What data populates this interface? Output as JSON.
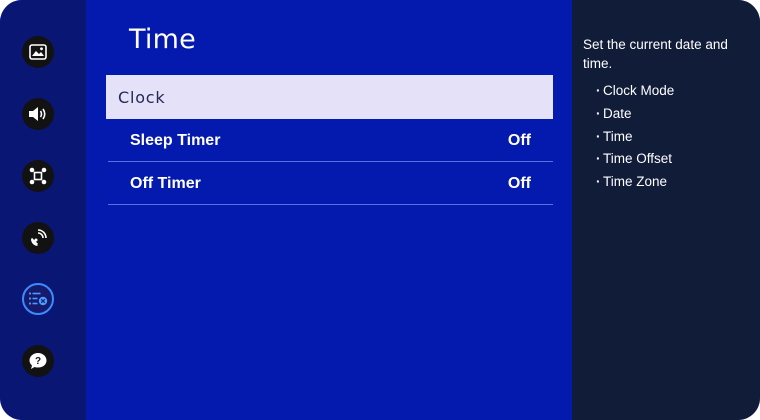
{
  "sidebar": {
    "items": [
      {
        "icon": "picture-icon",
        "active": false
      },
      {
        "icon": "sound-icon",
        "active": false
      },
      {
        "icon": "connection-icon",
        "active": false
      },
      {
        "icon": "broadcasting-icon",
        "active": false
      },
      {
        "icon": "general-settings-icon",
        "active": true
      },
      {
        "icon": "support-icon",
        "active": false
      }
    ],
    "active_color": "#3a8cff"
  },
  "menu": {
    "title": "Time",
    "clock_label": "Clock",
    "items": [
      {
        "label": "Sleep Timer",
        "value": "Off"
      },
      {
        "label": "Off Timer",
        "value": "Off"
      }
    ],
    "background_color": "#0419ad",
    "highlight_color": "#e4e1f8"
  },
  "help": {
    "description": "Set the current date and time.",
    "bullet": "·",
    "items": [
      "Clock Mode",
      "Date",
      "Time",
      "Time Offset",
      "Time Zone"
    ]
  }
}
